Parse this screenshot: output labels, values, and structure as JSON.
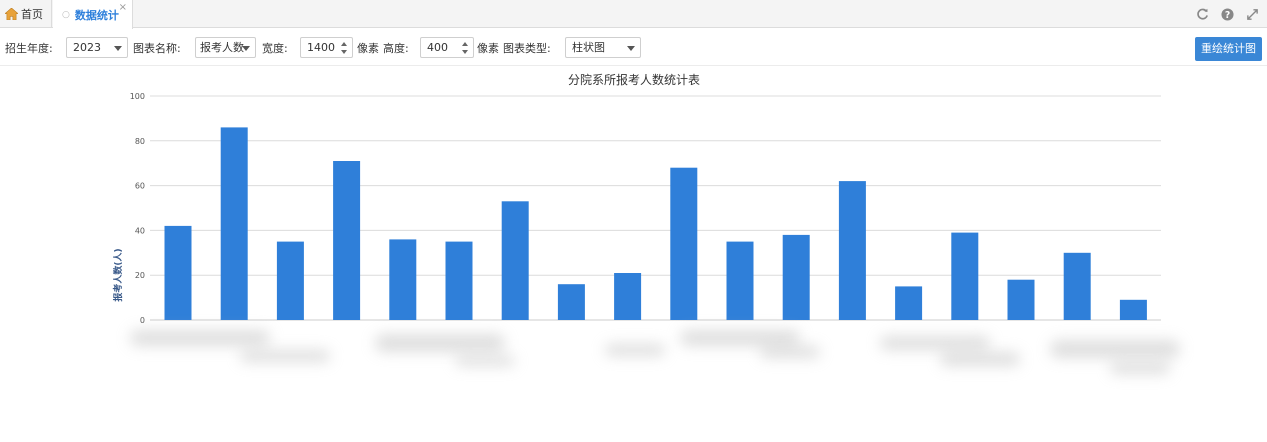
{
  "tabs": {
    "home_label": "首页",
    "stats_label": "数据统计",
    "close_glyph": "×"
  },
  "toolbar": {
    "year_label": "招生年度:",
    "year_value": "2023",
    "chart_name_label": "图表名称:",
    "chart_name_value": "报考人数",
    "width_label": "宽度:",
    "width_value": "1400",
    "width_unit": "像素",
    "height_label": "高度:",
    "height_value": "400",
    "height_unit": "像素",
    "chart_type_label": "图表类型:",
    "chart_type_value": "柱状图",
    "redraw_label": "重绘统计图"
  },
  "colors": {
    "bar": "#2f7fd9",
    "accent": "#3a87d6"
  },
  "chart_data": {
    "type": "bar",
    "title": "分院系所报考人数统计表",
    "ylabel": "报考人数(人)",
    "ylim": [
      0,
      100
    ],
    "yticks": [
      "0",
      "20",
      "40",
      "60",
      "80",
      "100"
    ],
    "values": [
      42,
      86,
      35,
      71,
      36,
      35,
      53,
      16,
      21,
      68,
      35,
      38,
      62,
      15,
      39,
      18,
      30,
      9
    ],
    "grid": true
  }
}
